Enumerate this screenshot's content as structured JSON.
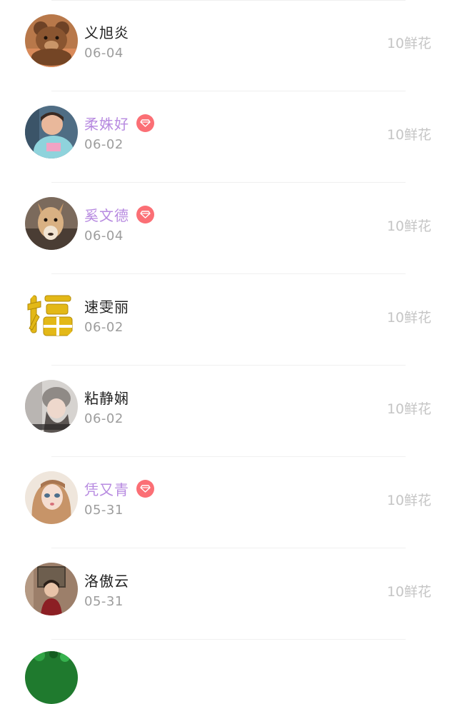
{
  "gift_rows": [
    {
      "name": "义旭炎",
      "date": "06-04",
      "gift": "10鲜花",
      "vip": false,
      "avatar": "teddy-bear-avatar"
    },
    {
      "name": "柔姝好",
      "date": "06-02",
      "gift": "10鲜花",
      "vip": true,
      "avatar": "child-avatar"
    },
    {
      "name": "奚文德",
      "date": "06-04",
      "gift": "10鲜花",
      "vip": true,
      "avatar": "alpaca-avatar"
    },
    {
      "name": "速雯丽",
      "date": "06-02",
      "gift": "10鲜花",
      "vip": false,
      "avatar": "fu-character-avatar"
    },
    {
      "name": "粘静娴",
      "date": "06-02",
      "gift": "10鲜花",
      "vip": false,
      "avatar": "girl-hat-avatar"
    },
    {
      "name": "凭又青",
      "date": "05-31",
      "gift": "10鲜花",
      "vip": true,
      "avatar": "doll-avatar"
    },
    {
      "name": "洛傲云",
      "date": "05-31",
      "gift": "10鲜花",
      "vip": false,
      "avatar": "portrait-avatar"
    }
  ],
  "icons": {
    "vip_badge": "diamond-icon",
    "partial_avatar": "green-plant-avatar"
  },
  "colors": {
    "name_default": "#222222",
    "name_vip": "#b78ae0",
    "date": "#9d9d9d",
    "gift": "#c5c5c5",
    "badge": "#fb6f75"
  }
}
